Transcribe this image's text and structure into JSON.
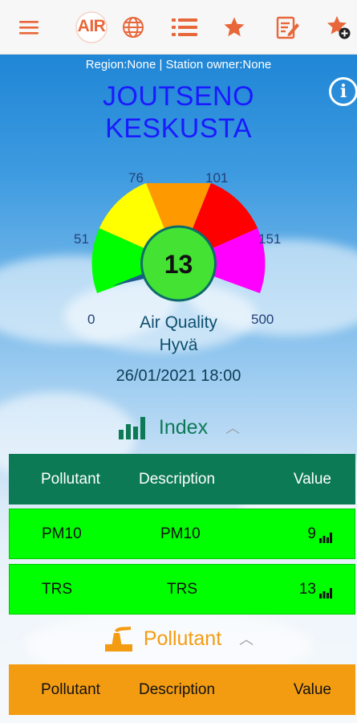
{
  "toolbar": {
    "app_logo": "AIR",
    "icons": [
      "menu-icon",
      "globe-icon",
      "list-icon",
      "star-icon",
      "edit-note-icon",
      "star-add-icon"
    ]
  },
  "station": {
    "meta": "Region:None | Station owner:None",
    "name_line1": "JOUTSENO",
    "name_line2": "KESKUSTA"
  },
  "gauge": {
    "value": "13",
    "labels": [
      "0",
      "51",
      "76",
      "101",
      "151",
      "500"
    ],
    "segment_colors": [
      "#00ff00",
      "#ffff00",
      "#ff9900",
      "#ff0000",
      "#ff00ff"
    ],
    "title": "Air Quality",
    "status": "Hyvä",
    "datetime": "26/01/2021 18:00"
  },
  "index_section": {
    "title": "Index",
    "header": {
      "pollutant": "Pollutant",
      "description": "Description",
      "value": "Value"
    },
    "rows": [
      {
        "pollutant": "PM10",
        "description": "PM10",
        "value": "9"
      },
      {
        "pollutant": "TRS",
        "description": "TRS",
        "value": "13"
      }
    ]
  },
  "pollutant_section": {
    "title": "Pollutant",
    "header": {
      "pollutant": "Pollutant",
      "description": "Description",
      "value": "Value"
    }
  },
  "colors": {
    "accent": "#e8673a",
    "index_green": "#0c7a55",
    "pollutant_orange": "#f39c12",
    "good_green": "#00ff00"
  }
}
